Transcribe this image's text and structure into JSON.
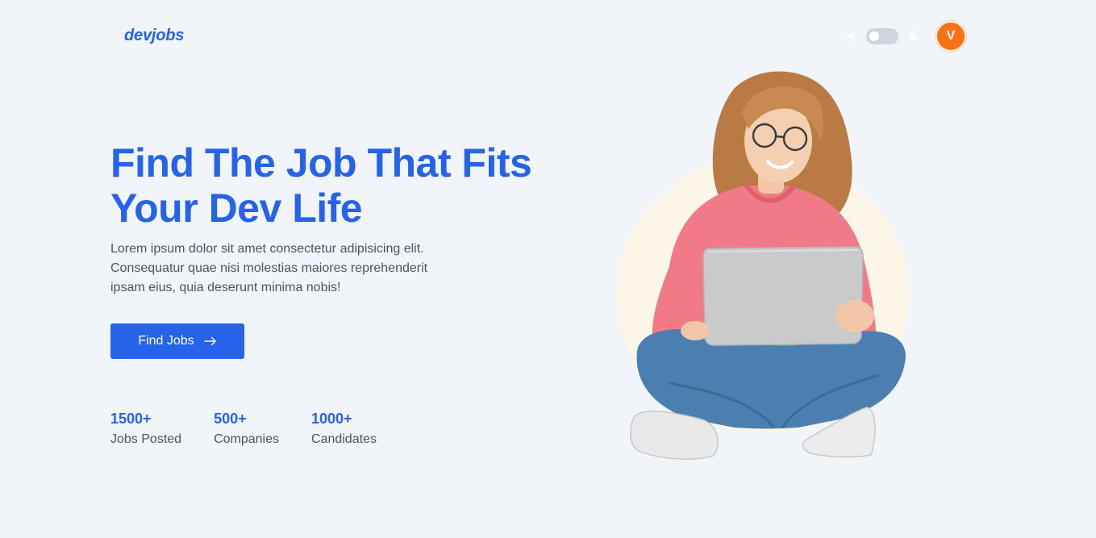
{
  "header": {
    "logo": "devjobs",
    "avatar_initial": "V",
    "theme_toggle": {
      "light_icon": "sun-icon",
      "dark_icon": "moon-icon",
      "state": "light"
    }
  },
  "hero": {
    "title_line1": "Find The Job That Fits",
    "title_line2": "Your Dev Life",
    "description": "Lorem ipsum dolor sit amet consectetur adipisicing elit. Consequatur quae nisi molestias maiores reprehenderit ipsam eius, quia deserunt minima nobis!",
    "cta_label": "Find Jobs",
    "cta_icon": "arrow-right-icon"
  },
  "stats": [
    {
      "value": "1500+",
      "label": "Jobs Posted"
    },
    {
      "value": "500+",
      "label": "Companies"
    },
    {
      "value": "1000+",
      "label": "Candidates"
    }
  ],
  "colors": {
    "accent": "#2563eb",
    "avatar": "#f97316",
    "background": "#f1f4f9",
    "hoodie": "#f07a86",
    "jeans": "#4a7fb0",
    "halo": "#fbf6e8"
  }
}
